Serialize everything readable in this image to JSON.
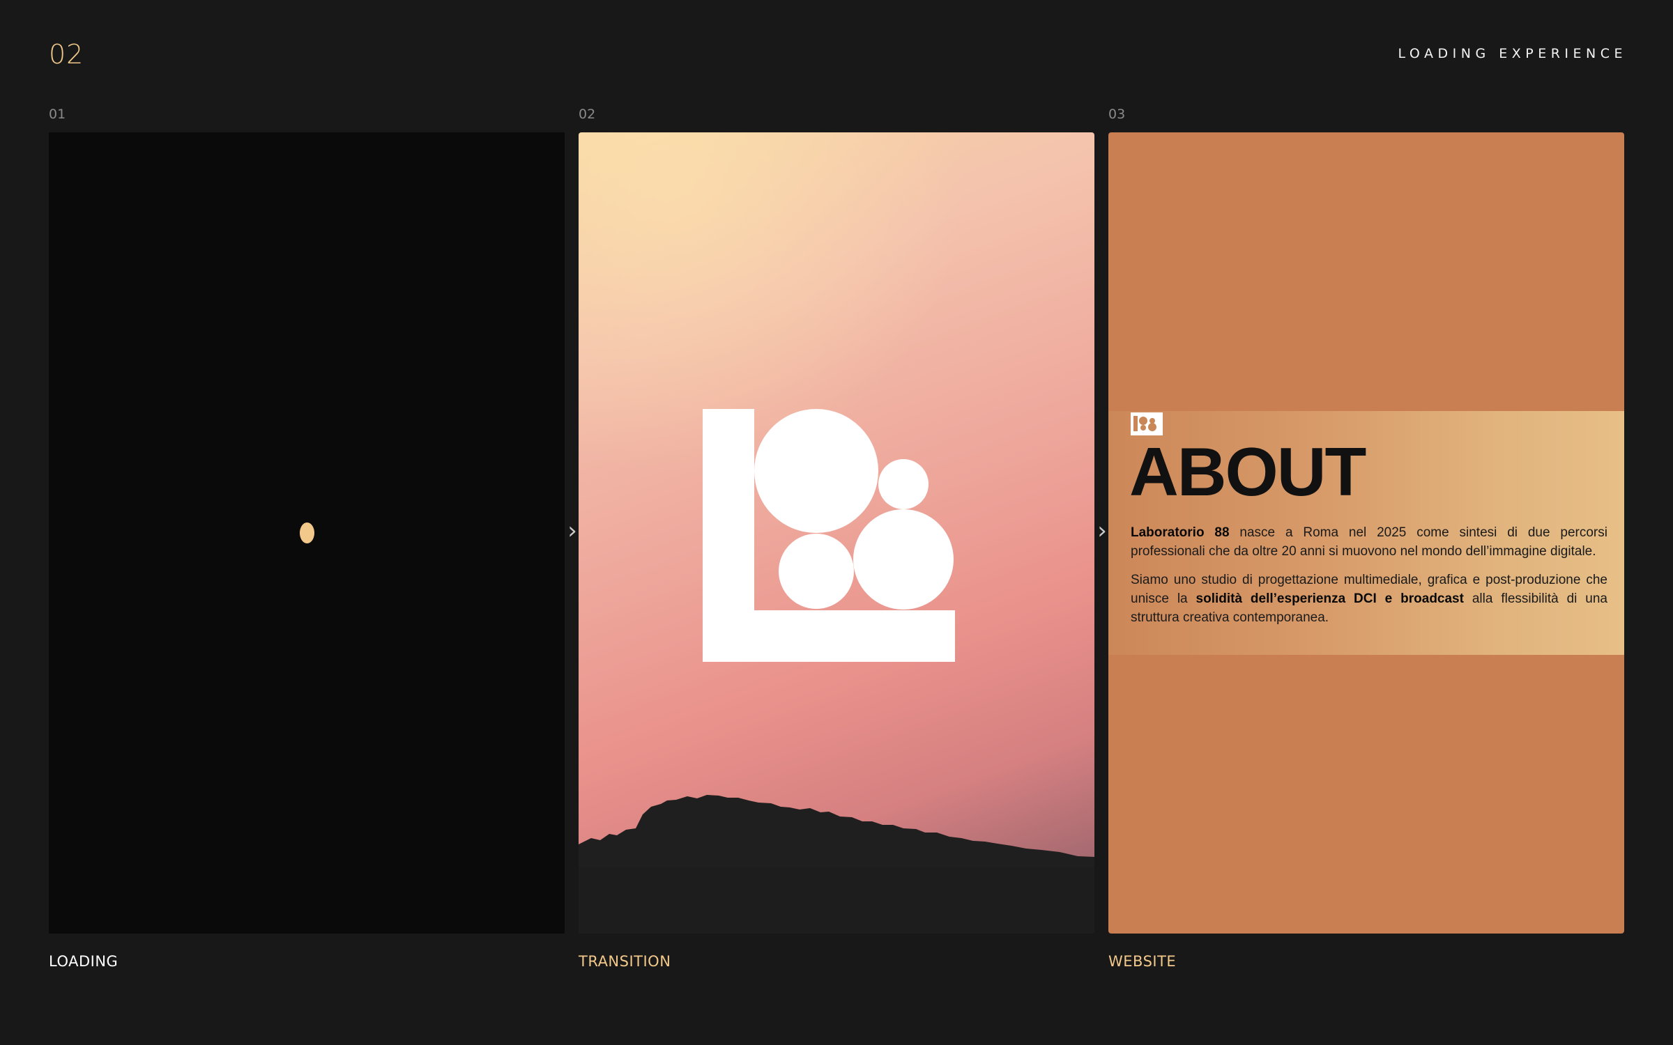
{
  "header": {
    "page_number": "02",
    "title": "LOADING EXPERIENCE"
  },
  "panels": [
    {
      "index": "01",
      "caption": "LOADING",
      "caption_color": "#ffffff",
      "background": "#0a0a0a"
    },
    {
      "index": "02",
      "caption": "TRANSITION",
      "caption_color": "#f3c98b",
      "background": "#eea89c"
    },
    {
      "index": "03",
      "caption": "WEBSITE",
      "caption_color": "#f3c98b",
      "background": "#c97f52"
    }
  ],
  "about": {
    "heading": "ABOUT",
    "paragraph_1": {
      "bold": "Laboratorio 88",
      "text": " nasce a Roma nel 2025 come sintesi di due percorsi professionali che da oltre 20 anni si muovono nel mondo dell’immagine digitale."
    },
    "paragraph_2": {
      "before": "Siamo uno studio di progettazione multimediale, grafica e post-produzione che unisce la ",
      "bold": "solidità dell’esperienza DCI e broadcast",
      "after": " alla flessibilità di una struttura creativa contemporanea."
    }
  },
  "icons": {
    "transition_arrow": "chevron-right-icon",
    "loading_indicator": "loading-dot-icon",
    "brand_logo": "laboratorio-88-logo"
  },
  "colors": {
    "accent": "#f3c98b",
    "page_background": "#181818"
  }
}
